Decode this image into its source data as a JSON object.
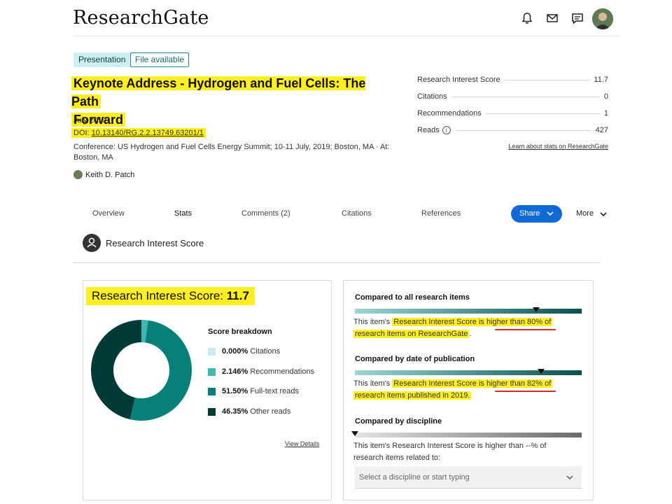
{
  "header": {
    "logo": "ResearchGate",
    "icons": [
      "bell-icon",
      "mail-icon",
      "message-icon",
      "avatar"
    ]
  },
  "publication": {
    "badge_type": "Presentation",
    "badge_file": "File available",
    "title_line1": "Keynote Address - Hydrogen and Fuel Cells: The Path",
    "title_line2": "Forward",
    "date": "July 2019",
    "doi_label": "DOI: ",
    "doi_value": "10.13140/RG.2.2.13749.63201/1",
    "conference": "Conference: US Hydrogen and Fuel Cells Energy Summit; 10-11 July, 2019; Boston, MA · At: Boston, MA",
    "author": "Keith D. Patch"
  },
  "stats": {
    "items": [
      {
        "label": "Research Interest Score",
        "value": "11.7"
      },
      {
        "label": "Citations",
        "value": "0"
      },
      {
        "label": "Recommendations",
        "value": "1"
      },
      {
        "label": "Reads",
        "value": "427"
      }
    ],
    "learn_link": "Learn about stats on ResearchGate"
  },
  "tabs": {
    "items": [
      "Overview",
      "Stats",
      "Comments (2)",
      "Citations",
      "References"
    ],
    "active": "Stats",
    "share": "Share",
    "more": "More"
  },
  "section": {
    "title": "Research Interest Score"
  },
  "ris_card": {
    "title_prefix": "Research Interest Score: ",
    "title_value": "11.7",
    "breakdown_heading": "Score breakdown",
    "view_details": "View Details",
    "colors": {
      "citations": "#c8ecef",
      "recommendations": "#3fb8b4",
      "fulltext": "#08807a",
      "other": "#023a37"
    }
  },
  "chart_data": {
    "type": "pie",
    "title": "",
    "categories": [
      "Citations",
      "Recommendations",
      "Full-text reads",
      "Other reads"
    ],
    "values": [
      0.0,
      2.146,
      51.5,
      46.35
    ],
    "value_labels": [
      "0.000%",
      "2.146%",
      "51.50%",
      "46.35%"
    ],
    "donut": true
  },
  "comparisons": {
    "all": {
      "heading": "Compared to all research items",
      "marker_fraction": 0.8,
      "text_pre": "This item's ",
      "text_hl_a": "Research Interest Score is ",
      "text_hl_b": "higher than 80%",
      "text_hl_c": " of",
      "text_line2": "research items on ResearchGate",
      "text_end": "."
    },
    "date": {
      "heading": "Compared by date of publication",
      "marker_fraction": 0.82,
      "text_pre": "This item's ",
      "text_hl_a": "Research Interest Score is ",
      "text_hl_b": "higher than 82%",
      "text_hl_c": " of",
      "text_line2": "research items published in 2019."
    },
    "discipline": {
      "heading": "Compared by discipline",
      "marker_fraction": 0.0,
      "text_line1": "This item's Research Interest Score is higher than --% of",
      "text_line2": "research items related to:",
      "select_placeholder": "Select a discipline or start typing"
    }
  }
}
